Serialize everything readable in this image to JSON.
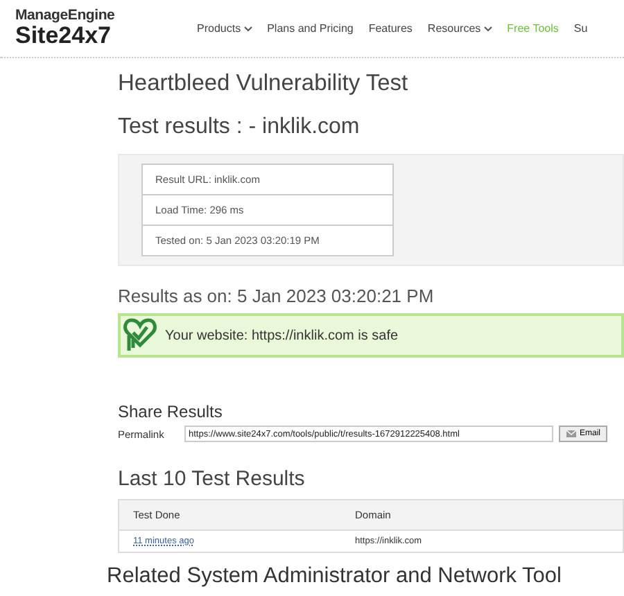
{
  "header": {
    "logo_top": "ManageEngine",
    "logo_bottom": "Site24x7",
    "nav": [
      {
        "label": "Products",
        "dropdown": true,
        "selected": false
      },
      {
        "label": "Plans and Pricing",
        "dropdown": false,
        "selected": false
      },
      {
        "label": "Features",
        "dropdown": false,
        "selected": false
      },
      {
        "label": "Resources",
        "dropdown": true,
        "selected": false
      },
      {
        "label": "Free Tools",
        "dropdown": false,
        "selected": true
      },
      {
        "label": "Su",
        "dropdown": false,
        "selected": false
      }
    ]
  },
  "title": "Heartbleed Vulnerability Test",
  "subtitle": "Test results : - inklik.com",
  "result_details": [
    "Result URL: inklik.com",
    "Load Time: 296 ms",
    "Tested on: 5 Jan 2023 03:20:19 PM"
  ],
  "results_as_on": "Results as on: 5 Jan 2023 03:20:21 PM",
  "status": {
    "message": "Your website: https://inklik.com is safe"
  },
  "share": {
    "heading": "Share Results",
    "label": "Permalink",
    "url": "https://www.site24x7.com/tools/public/t/results-1672912225408.html",
    "button": "Email"
  },
  "history": {
    "heading": "Last 10 Test Results",
    "columns": [
      "Test Done",
      "Domain"
    ],
    "rows": [
      [
        "11 minutes ago",
        "https://inklik.com"
      ]
    ]
  },
  "related_heading": "Related System Administrator and Network Tool"
}
